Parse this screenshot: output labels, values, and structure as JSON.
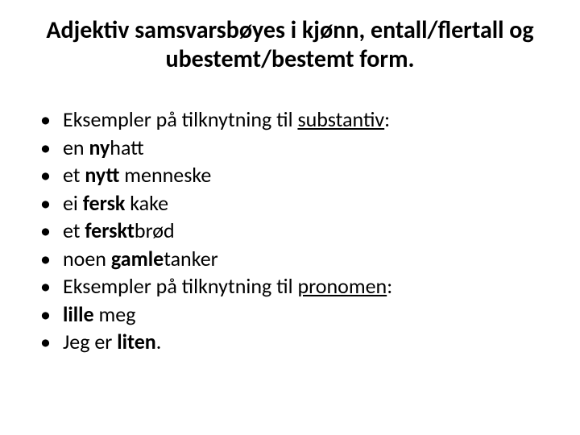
{
  "title": "Adjektiv samsvarsbøyes i kjønn, entall/flertall og ubestemt/bestemt form.",
  "items": [
    {
      "segments": [
        {
          "text": "Eksempler på tilknytning til "
        },
        {
          "text": "substantiv",
          "link": true
        },
        {
          "text": ":"
        }
      ]
    },
    {
      "segments": [
        {
          "text": "en "
        },
        {
          "text": "ny",
          "bold": true
        },
        {
          "text": "hatt"
        }
      ]
    },
    {
      "segments": [
        {
          "text": "et "
        },
        {
          "text": "nytt",
          "bold": true
        },
        {
          "text": " menneske"
        }
      ]
    },
    {
      "segments": [
        {
          "text": "ei "
        },
        {
          "text": "fersk",
          "bold": true
        },
        {
          "text": " kake"
        }
      ]
    },
    {
      "segments": [
        {
          "text": "et "
        },
        {
          "text": "ferskt",
          "bold": true
        },
        {
          "text": "brød"
        }
      ]
    },
    {
      "segments": [
        {
          "text": "noen "
        },
        {
          "text": "gamle",
          "bold": true
        },
        {
          "text": "tanker"
        }
      ]
    },
    {
      "segments": [
        {
          "text": "Eksempler på tilknytning til "
        },
        {
          "text": "pronomen",
          "link": true
        },
        {
          "text": ":"
        }
      ]
    },
    {
      "segments": [
        {
          "text": "lille",
          "bold": true
        },
        {
          "text": " meg"
        }
      ]
    },
    {
      "segments": [
        {
          "text": "Jeg er "
        },
        {
          "text": "liten",
          "bold": true
        },
        {
          "text": "."
        }
      ]
    }
  ]
}
